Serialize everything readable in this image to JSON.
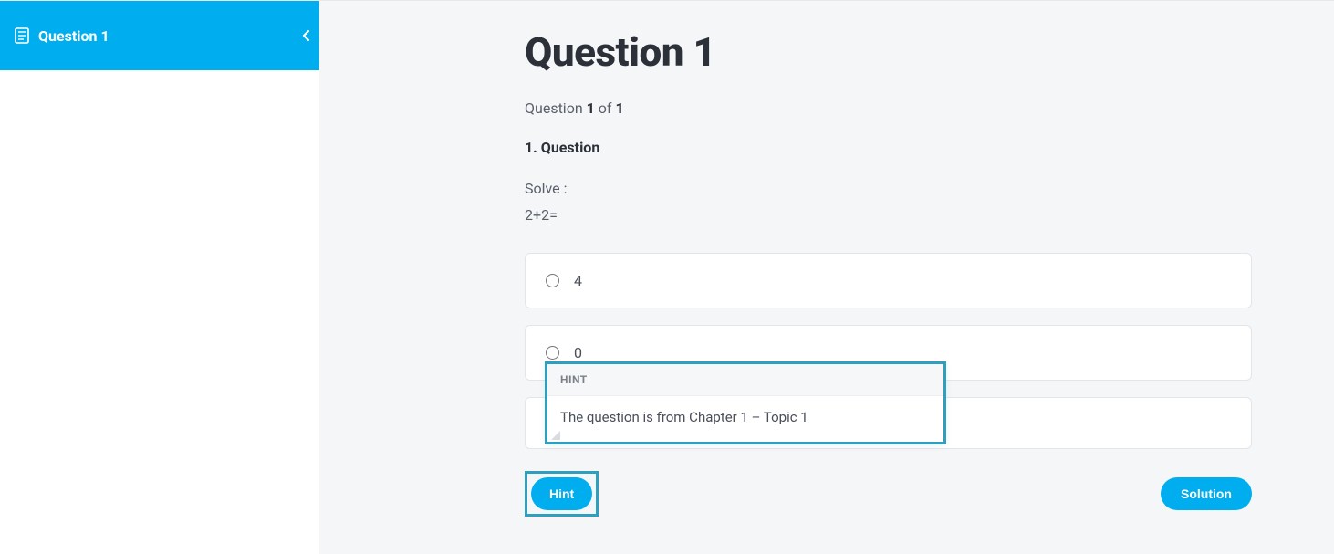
{
  "sidebar": {
    "item_label": "Question 1"
  },
  "main": {
    "title": "Question 1",
    "progress_prefix": "Question ",
    "progress_current": "1",
    "progress_mid": " of ",
    "progress_total": "1",
    "question_number_label": "1. Question",
    "prompt_line1": "Solve :",
    "prompt_line2": "2+2=",
    "options": [
      {
        "label": "4"
      },
      {
        "label": "0"
      },
      {
        "label": ""
      }
    ],
    "hint_button": "Hint",
    "solution_button": "Solution"
  },
  "hint": {
    "header": "HINT",
    "body": "The question is from Chapter 1 – Topic 1"
  }
}
